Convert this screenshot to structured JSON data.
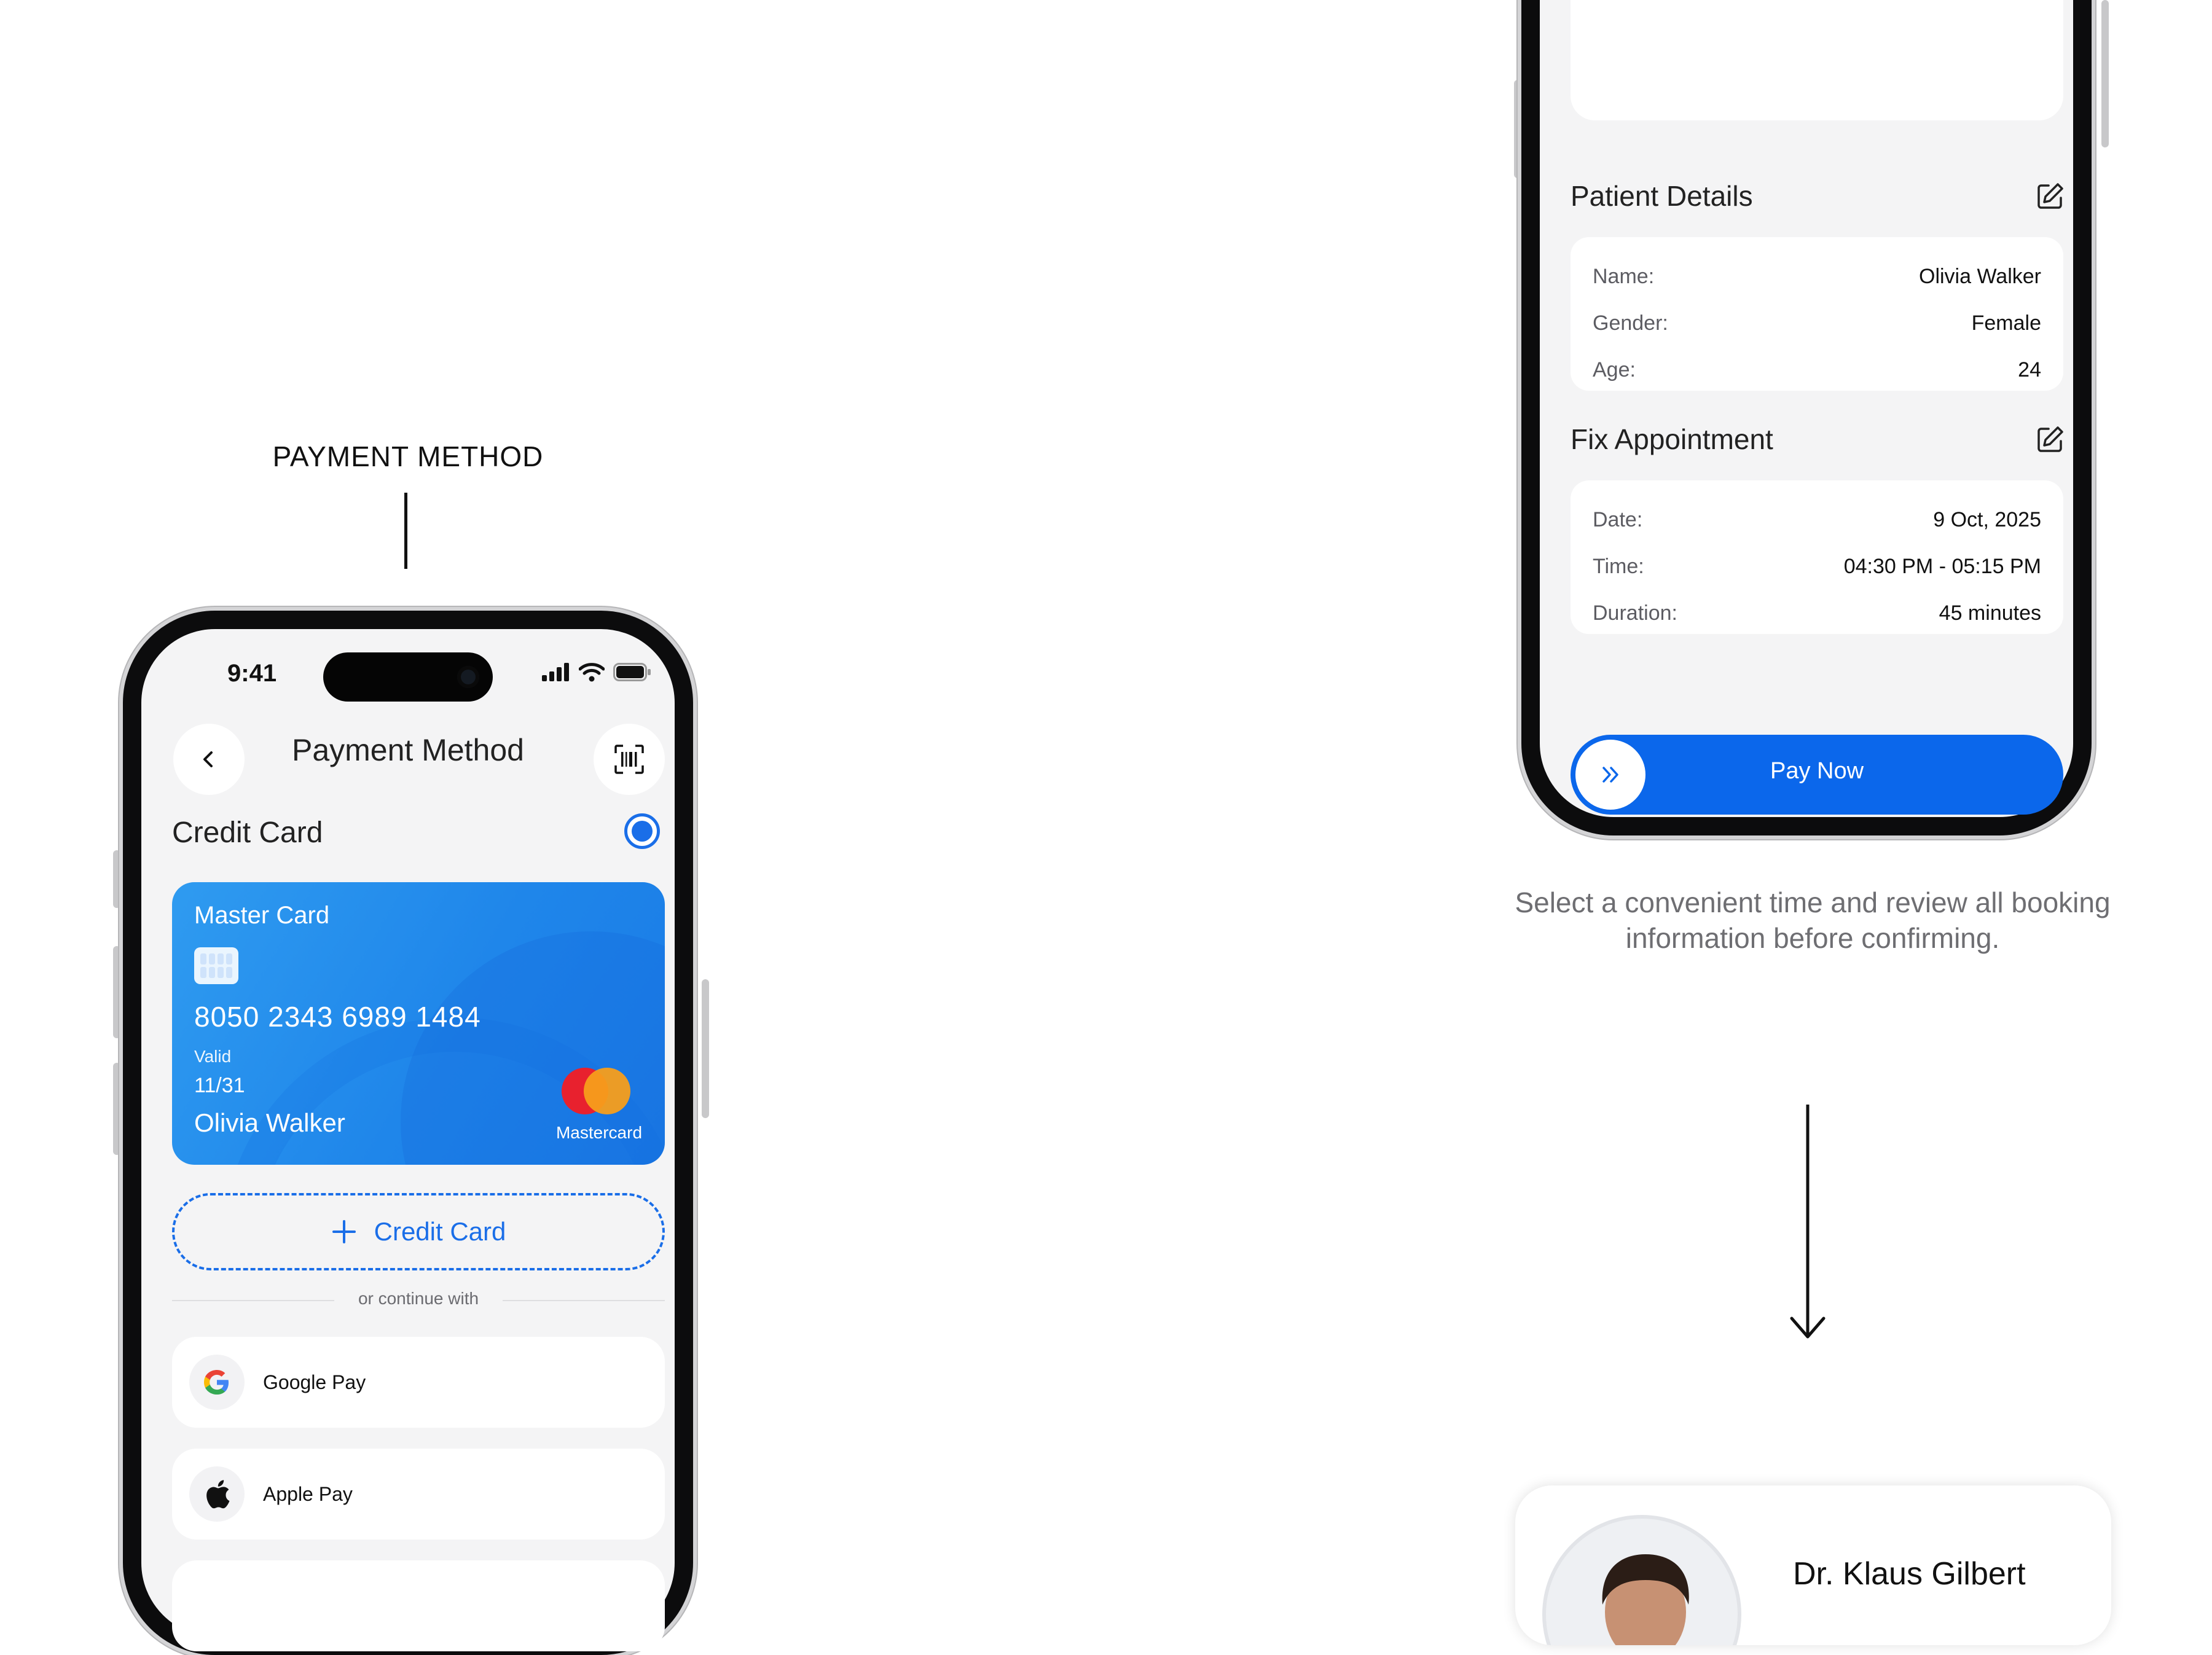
{
  "annotation": {
    "label": "PAYMENT METHOD"
  },
  "payment_screen": {
    "status_bar": {
      "time": "9:41"
    },
    "header": {
      "title": "Payment Method",
      "back_icon": "chevron-left-icon",
      "scan_icon": "barcode-scan-icon"
    },
    "credit_card_section": {
      "title": "Credit Card",
      "selected": true
    },
    "card": {
      "bank": "Master Card",
      "number": "8050 2343 6989 1484",
      "valid_label": "Valid",
      "valid_thru": "11/31",
      "holder": "Olivia Walker",
      "network": "Mastercard"
    },
    "add_card_label": "Credit Card",
    "divider_text": "or continue with",
    "pay_options": [
      {
        "label": "Google Pay",
        "icon": "google-icon"
      },
      {
        "label": "Apple Pay",
        "icon": "apple-icon"
      }
    ]
  },
  "booking_screen": {
    "patient_details": {
      "title": "Patient Details",
      "rows": [
        {
          "key": "Name:",
          "value": "Olivia Walker"
        },
        {
          "key": "Gender:",
          "value": "Female"
        },
        {
          "key": "Age:",
          "value": "24"
        }
      ]
    },
    "appointment": {
      "title": "Fix Appointment",
      "rows": [
        {
          "key": "Date:",
          "value": "9 Oct, 2025"
        },
        {
          "key": "Time:",
          "value": "04:30 PM - 05:15 PM"
        },
        {
          "key": "Duration:",
          "value": "45 minutes"
        }
      ]
    },
    "pay_button": "Pay Now"
  },
  "caption": "Select a convenient time and review all booking information before confirming.",
  "doctor_card": {
    "name": "Dr. Klaus Gilbert"
  },
  "colors": {
    "accent": "#0b67eb",
    "card": "#1f86ea",
    "background": "#f4f4f5"
  }
}
